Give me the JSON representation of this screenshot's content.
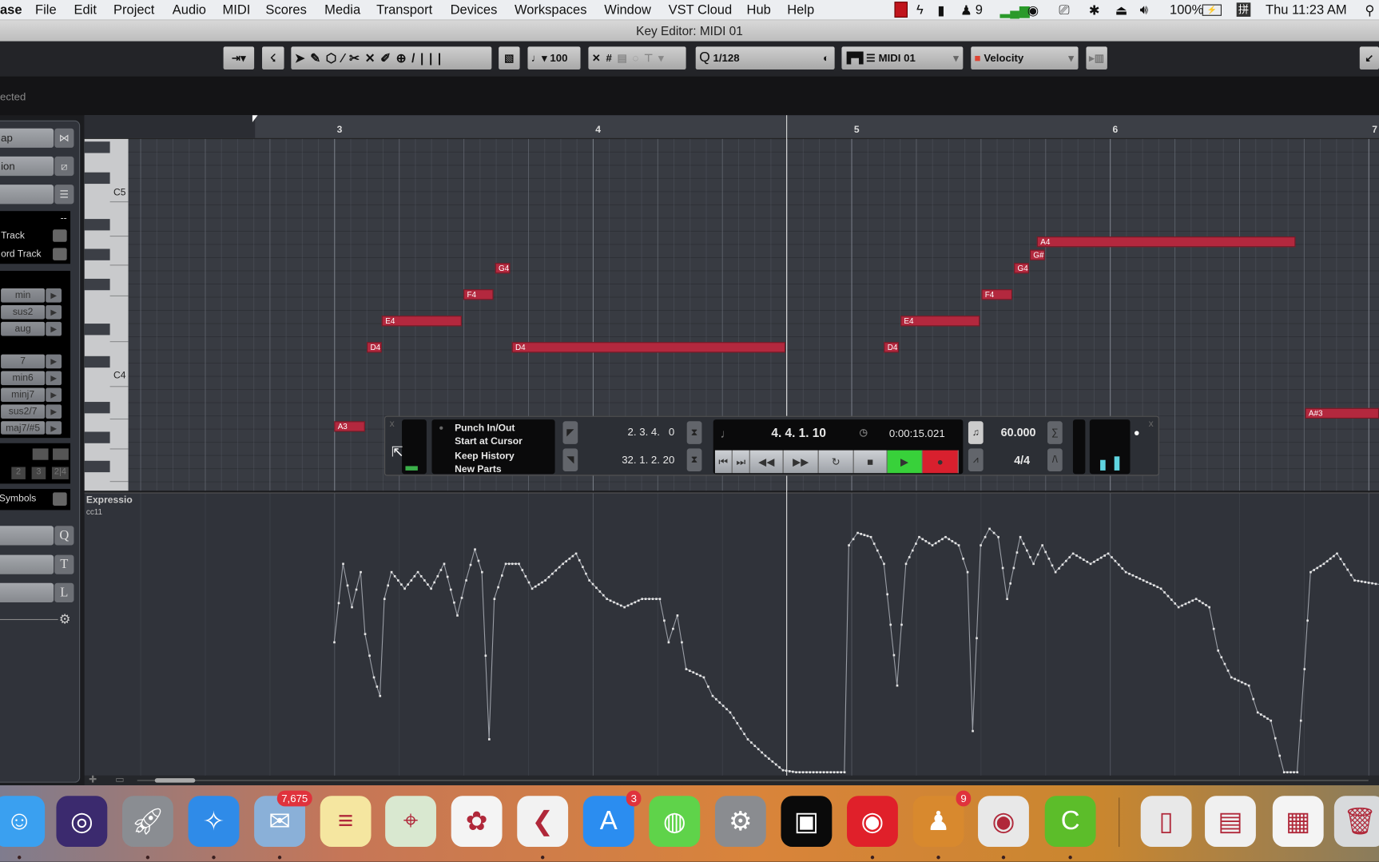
{
  "menubar": {
    "app": "ase",
    "items": [
      "File",
      "Edit",
      "Project",
      "Audio",
      "MIDI",
      "Scores",
      "Media",
      "Transport",
      "Devices",
      "Workspaces",
      "Window",
      "VST Cloud",
      "Hub",
      "Help"
    ],
    "notification_count": "9",
    "battery": "100%",
    "clock": "Thu 11:23 AM"
  },
  "window": {
    "title": "Key Editor: MIDI 01"
  },
  "toolbar": {
    "velocity_value": "100",
    "quantize": "1/128",
    "track": "MIDI 01",
    "controller": "Velocity"
  },
  "infoline": {
    "text": "ected"
  },
  "left_panel": {
    "buttons": [
      "ap",
      "ion",
      ""
    ],
    "black_header": "--",
    "track_items": [
      "Track",
      "ord Track"
    ],
    "chords_a": [
      "min",
      "sus2",
      "aug"
    ],
    "chords_b": [
      "7",
      "min6",
      "minj7",
      "sus2/7",
      "maj7/#5"
    ],
    "voicing": [
      "2",
      "3",
      "2|4"
    ],
    "symbols": "Symbols",
    "side_letters": [
      "Q",
      "T",
      "L"
    ]
  },
  "ruler": {
    "bars": [
      "3",
      "4",
      "5",
      "6",
      "7"
    ]
  },
  "keyboard": {
    "labels": [
      "C5",
      "C4"
    ]
  },
  "notes": [
    {
      "label": "A3",
      "pitch": "A3",
      "start": 3.0,
      "end": 3.12
    },
    {
      "label": "D4",
      "pitch": "D4",
      "start": 3.126,
      "end": 3.184
    },
    {
      "label": "E4",
      "pitch": "E4",
      "start": 3.184,
      "end": 3.493
    },
    {
      "label": "F4",
      "pitch": "F4",
      "start": 3.5,
      "end": 3.616
    },
    {
      "label": "G4",
      "pitch": "G4",
      "start": 3.622,
      "end": 3.68
    },
    {
      "label": "D4",
      "pitch": "D4",
      "start": 3.687,
      "end": 4.745
    },
    {
      "label": "D4",
      "pitch": "D4",
      "start": 5.126,
      "end": 5.184
    },
    {
      "label": "E4",
      "pitch": "E4",
      "start": 5.19,
      "end": 5.497
    },
    {
      "label": "F4",
      "pitch": "F4",
      "start": 5.503,
      "end": 5.622
    },
    {
      "label": "G4",
      "pitch": "G4",
      "start": 5.629,
      "end": 5.687
    },
    {
      "label": "G#",
      "pitch": "G#4",
      "start": 5.69,
      "end": 5.748
    },
    {
      "label": "A4",
      "pitch": "A4",
      "start": 5.718,
      "end": 6.718
    },
    {
      "label": "A#3",
      "pitch": "A#3",
      "start": 6.755,
      "end": 7.05
    }
  ],
  "cc_lane": {
    "name": "Expressio",
    "cc": "cc11",
    "range": [
      0,
      127
    ],
    "points": [
      [
        3.0,
        63
      ],
      [
        3.034,
        101
      ],
      [
        3.068,
        80
      ],
      [
        3.102,
        97
      ],
      [
        3.119,
        67
      ],
      [
        3.153,
        46
      ],
      [
        3.177,
        37
      ],
      [
        3.194,
        84
      ],
      [
        3.221,
        97
      ],
      [
        3.272,
        89
      ],
      [
        3.323,
        97
      ],
      [
        3.374,
        89
      ],
      [
        3.425,
        101
      ],
      [
        3.476,
        76
      ],
      [
        3.51,
        93
      ],
      [
        3.544,
        108
      ],
      [
        3.571,
        97
      ],
      [
        3.599,
        16
      ],
      [
        3.619,
        84
      ],
      [
        3.663,
        101
      ],
      [
        3.714,
        101
      ],
      [
        3.765,
        89
      ],
      [
        3.816,
        93
      ],
      [
        3.884,
        101
      ],
      [
        3.935,
        106
      ],
      [
        3.986,
        93
      ],
      [
        4.054,
        84
      ],
      [
        4.122,
        80
      ],
      [
        4.19,
        84
      ],
      [
        4.259,
        84
      ],
      [
        4.293,
        63
      ],
      [
        4.327,
        76
      ],
      [
        4.361,
        50
      ],
      [
        4.429,
        46
      ],
      [
        4.463,
        37
      ],
      [
        4.531,
        29
      ],
      [
        4.599,
        16
      ],
      [
        4.667,
        8
      ],
      [
        4.735,
        1
      ],
      [
        4.786,
        0
      ],
      [
        4.973,
        0
      ],
      [
        4.99,
        110
      ],
      [
        5.024,
        116
      ],
      [
        5.075,
        114
      ],
      [
        5.126,
        101
      ],
      [
        5.177,
        42
      ],
      [
        5.211,
        101
      ],
      [
        5.262,
        114
      ],
      [
        5.313,
        110
      ],
      [
        5.364,
        114
      ],
      [
        5.415,
        110
      ],
      [
        5.449,
        97
      ],
      [
        5.469,
        20
      ],
      [
        5.5,
        110
      ],
      [
        5.534,
        118
      ],
      [
        5.568,
        114
      ],
      [
        5.602,
        84
      ],
      [
        5.653,
        114
      ],
      [
        5.704,
        101
      ],
      [
        5.738,
        110
      ],
      [
        5.789,
        97
      ],
      [
        5.857,
        106
      ],
      [
        5.925,
        101
      ],
      [
        5.993,
        106
      ],
      [
        6.061,
        97
      ],
      [
        6.129,
        93
      ],
      [
        6.197,
        89
      ],
      [
        6.265,
        80
      ],
      [
        6.333,
        84
      ],
      [
        6.384,
        80
      ],
      [
        6.418,
        59
      ],
      [
        6.469,
        46
      ],
      [
        6.537,
        42
      ],
      [
        6.571,
        29
      ],
      [
        6.622,
        25
      ],
      [
        6.656,
        8
      ],
      [
        6.673,
        0
      ],
      [
        6.724,
        0
      ],
      [
        6.752,
        50
      ],
      [
        6.776,
        97
      ],
      [
        6.827,
        101
      ],
      [
        6.878,
        106
      ],
      [
        6.946,
        93
      ],
      [
        7.041,
        91
      ]
    ]
  },
  "transport": {
    "punch": "Punch In/Out",
    "start_at_cursor": "Start at Cursor",
    "keep_history": "Keep History",
    "new_parts": "New Parts",
    "left_locator": "2. 3. 4.   0",
    "right_locator": "32. 1. 2. 20",
    "position_bars": "4. 4. 1. 10",
    "position_time": "0:00:15.021",
    "tempo": "60.000",
    "signature": "4/4",
    "close": "x"
  },
  "dock": {
    "apps": [
      {
        "name": "finder",
        "badge": "",
        "color": "#3aa0f0"
      },
      {
        "name": "siri",
        "badge": "",
        "color": "#3b2a6e"
      },
      {
        "name": "launchpad",
        "badge": "",
        "color": "#8a8d92"
      },
      {
        "name": "safari",
        "badge": "",
        "color": "#2f8be8"
      },
      {
        "name": "mail",
        "badge": "7,675",
        "color": "#8ab0d8"
      },
      {
        "name": "notes",
        "badge": "",
        "color": "#f5e6a0"
      },
      {
        "name": "maps",
        "badge": "",
        "color": "#d9e8d0"
      },
      {
        "name": "photos",
        "badge": "",
        "color": "#f4f4f4"
      },
      {
        "name": "cubase",
        "badge": "",
        "color": "#f2f2f2"
      },
      {
        "name": "app-store",
        "badge": "3",
        "color": "#2b8df0"
      },
      {
        "name": "wechat",
        "badge": "",
        "color": "#5fd34a"
      },
      {
        "name": "system-preferences",
        "badge": "",
        "color": "#8a8c90"
      },
      {
        "name": "screen-capture",
        "badge": "",
        "color": "#0a0a0a"
      },
      {
        "name": "netease-music",
        "badge": "",
        "color": "#e0202a"
      },
      {
        "name": "qq",
        "badge": "9",
        "color": "#d8892e"
      },
      {
        "name": "chrome",
        "badge": "",
        "color": "#e8e8e8"
      },
      {
        "name": "camtasia",
        "badge": "",
        "color": "#5cbd2a"
      },
      {
        "name": "disk-utility",
        "badge": "",
        "color": "#e8e8e8"
      },
      {
        "name": "window-preview-1",
        "badge": "",
        "color": "#f0f0f0"
      },
      {
        "name": "window-preview-2",
        "badge": "",
        "color": "#f4f4f4"
      },
      {
        "name": "trash",
        "badge": "",
        "color": "#d8dadc"
      }
    ]
  },
  "colors": {
    "note": "#b3283e",
    "play": "#38d13a",
    "record": "#d8202e",
    "cc_line": "#e6e6e6"
  }
}
